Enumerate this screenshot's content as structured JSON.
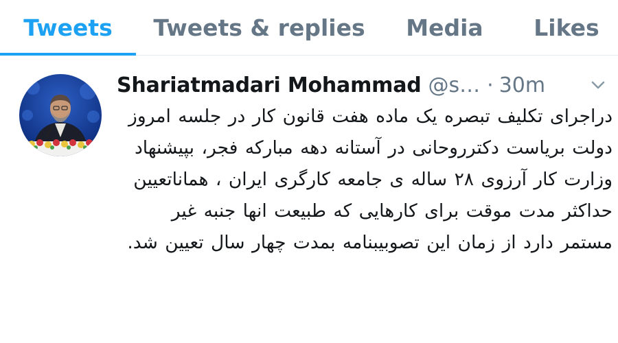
{
  "tabs": {
    "tweets": "Tweets",
    "replies": "Tweets & replies",
    "media": "Media",
    "likes": "Likes",
    "active": "Tweets"
  },
  "tweet": {
    "author_name": "Shariatmadari Mohammad",
    "handle": "@s…",
    "separator": "·",
    "timestamp": "30m",
    "text": "دراجرای تکلیف تبصره یک ماده هفت قانون کار در جلسه امروز دولت بریاست دکترروحانی در آستانه دهه مبارکه فجر، بپیشنهاد وزارت کار آرزوی ۲۸ ساله ی جامعه کارگری ایران ، هماناتعیین حداکثر مدت موقت برای کارهایی که طبیعت انها جنبه غیر مستمر دارد از زمان این تصوبیبنامه بمدت چهار سال تعیین شد."
  },
  "icons": {
    "more": "chevron-down-icon"
  },
  "colors": {
    "accent": "#1da1f2",
    "tab_inactive": "#657786",
    "text": "#14171a",
    "muted": "#657786",
    "divider": "#e6ecf0"
  }
}
